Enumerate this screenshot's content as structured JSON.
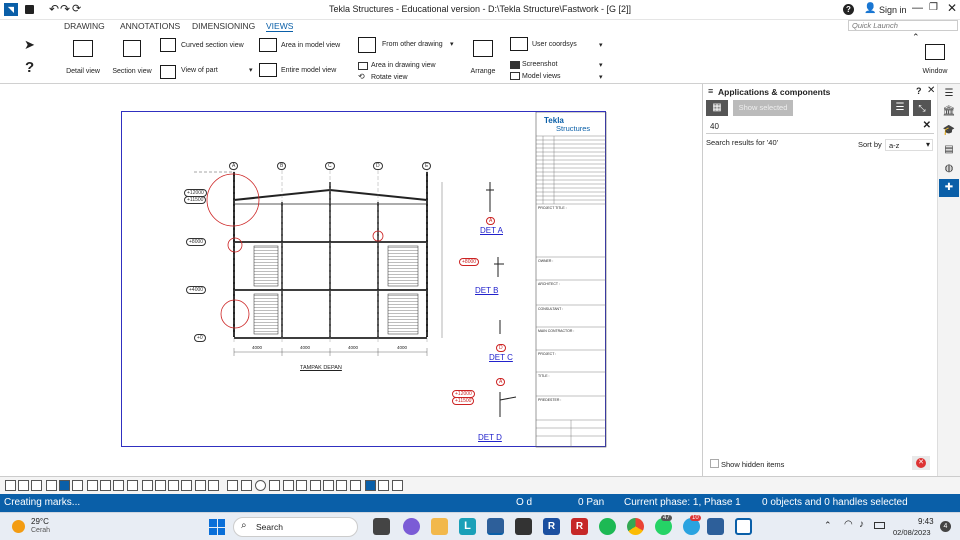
{
  "window": {
    "title": "Tekla Structures - Educational version - D:\\Tekla Structure\\Fastwork - [G  [2]]"
  },
  "header": {
    "sign_in": "Sign in",
    "quick_launch_placeholder": "Quick Launch"
  },
  "tabs": [
    "DRAWING",
    "ANNOTATIONS",
    "DIMENSIONING",
    "VIEWS"
  ],
  "ribbon": {
    "detail_view": "Detail view",
    "section_view": "Section view",
    "curved_section_view": "Curved section view",
    "view_of_part": "View of part",
    "area_in_model_view": "Area in model view",
    "entire_model_view": "Entire model view",
    "from_other_drawing": "From other drawing",
    "area_in_drawing_view": "Area in drawing view",
    "rotate_view": "Rotate view",
    "arrange": "Arrange",
    "user_coordsys": "User coordsys",
    "screenshot": "Screenshot",
    "model_views": "Model views",
    "window": "Window"
  },
  "panel": {
    "title": "Applications & components",
    "show_selected": "Show selected",
    "search_value": "40",
    "results_text": "Search results for '40'",
    "sort_by_label": "Sort by",
    "sort_value": "a-z",
    "show_hidden": "Show hidden items"
  },
  "drawing": {
    "logo_line1": "Tekla",
    "logo_line2": "Structures",
    "grid_labels": [
      "A",
      "B",
      "C",
      "D",
      "E"
    ],
    "elevations": [
      "+12000",
      "+11500",
      "+8000",
      "+4000",
      "+0"
    ],
    "dims": [
      "4000",
      "4000",
      "4000",
      "4000"
    ],
    "view_title": "TAMPAK DEPAN",
    "details": [
      "DET A",
      "DET B",
      "DET C",
      "DET D"
    ],
    "det_bubbles": [
      "A",
      "A",
      "D",
      "A"
    ],
    "det_elev_b": "+8000",
    "det_elev_d1": "+12000",
    "det_elev_d2": "+11500",
    "tb_labels": [
      "PROJECT TITLE :",
      "OWNER :",
      "ARCHITECT :",
      "CONSULTANT :",
      "MAIN CONTRACTOR :",
      "PROJECT :",
      "TITLE :",
      "PREDESTER :"
    ]
  },
  "status": {
    "message": "Creating marks...",
    "od": "O d",
    "pan": "0 Pan",
    "phase": "Current phase: 1, Phase 1",
    "selection": "0 objects and 0 handles selected"
  },
  "taskbar": {
    "temp": "29°C",
    "weather": "Cerah",
    "weather_badge": "4",
    "search": "Search",
    "time": "9:43",
    "date": "02/08/2023",
    "badge_1": "47",
    "badge_2": "10"
  }
}
